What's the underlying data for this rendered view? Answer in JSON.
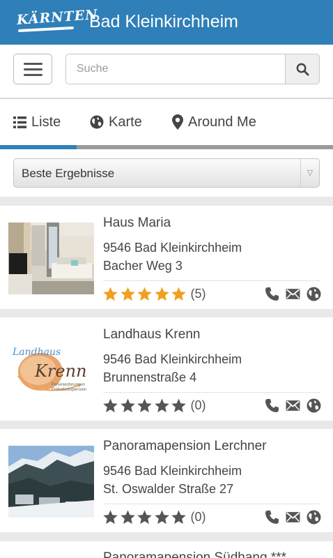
{
  "header": {
    "logo_text": "KÄRNTEN",
    "title": "Bad Kleinkirchheim"
  },
  "search": {
    "placeholder": "Suche",
    "value": ""
  },
  "tabs": [
    {
      "label": "Liste",
      "icon": "list-icon",
      "active": true
    },
    {
      "label": "Karte",
      "icon": "globe-icon",
      "active": false
    },
    {
      "label": "Around Me",
      "icon": "map-pin-icon",
      "active": false
    }
  ],
  "sort": {
    "selected": "Beste Ergebnisse"
  },
  "colors": {
    "header": "#2f7fb8",
    "tab_active": "#2f7fb8",
    "star_filled": "#f0a01e",
    "star_empty": "#555555"
  },
  "listings": [
    {
      "name": "Haus Maria",
      "postal_city": "9546 Bad Kleinkirchheim",
      "street": "Bacher Weg 3",
      "rating": 5,
      "max_rating": 5,
      "reviews": "(5)"
    },
    {
      "name": "Landhaus Krenn",
      "postal_city": "9546 Bad Kleinkirchheim",
      "street": "Brunnenstraße 4",
      "rating": 0,
      "max_rating": 5,
      "reviews": "(0)",
      "logo_text": {
        "top": "Landhaus",
        "name": "Krenn",
        "sub1": "Ferienwohnungen",
        "sub2": "Frühstückspension"
      }
    },
    {
      "name": "Panoramapension Lerchner",
      "postal_city": "9546 Bad Kleinkirchheim",
      "street": "St. Oswalder Straße 27",
      "rating": 0,
      "max_rating": 5,
      "reviews": "(0)"
    },
    {
      "name": "Panoramapension Südhang ***"
    }
  ]
}
